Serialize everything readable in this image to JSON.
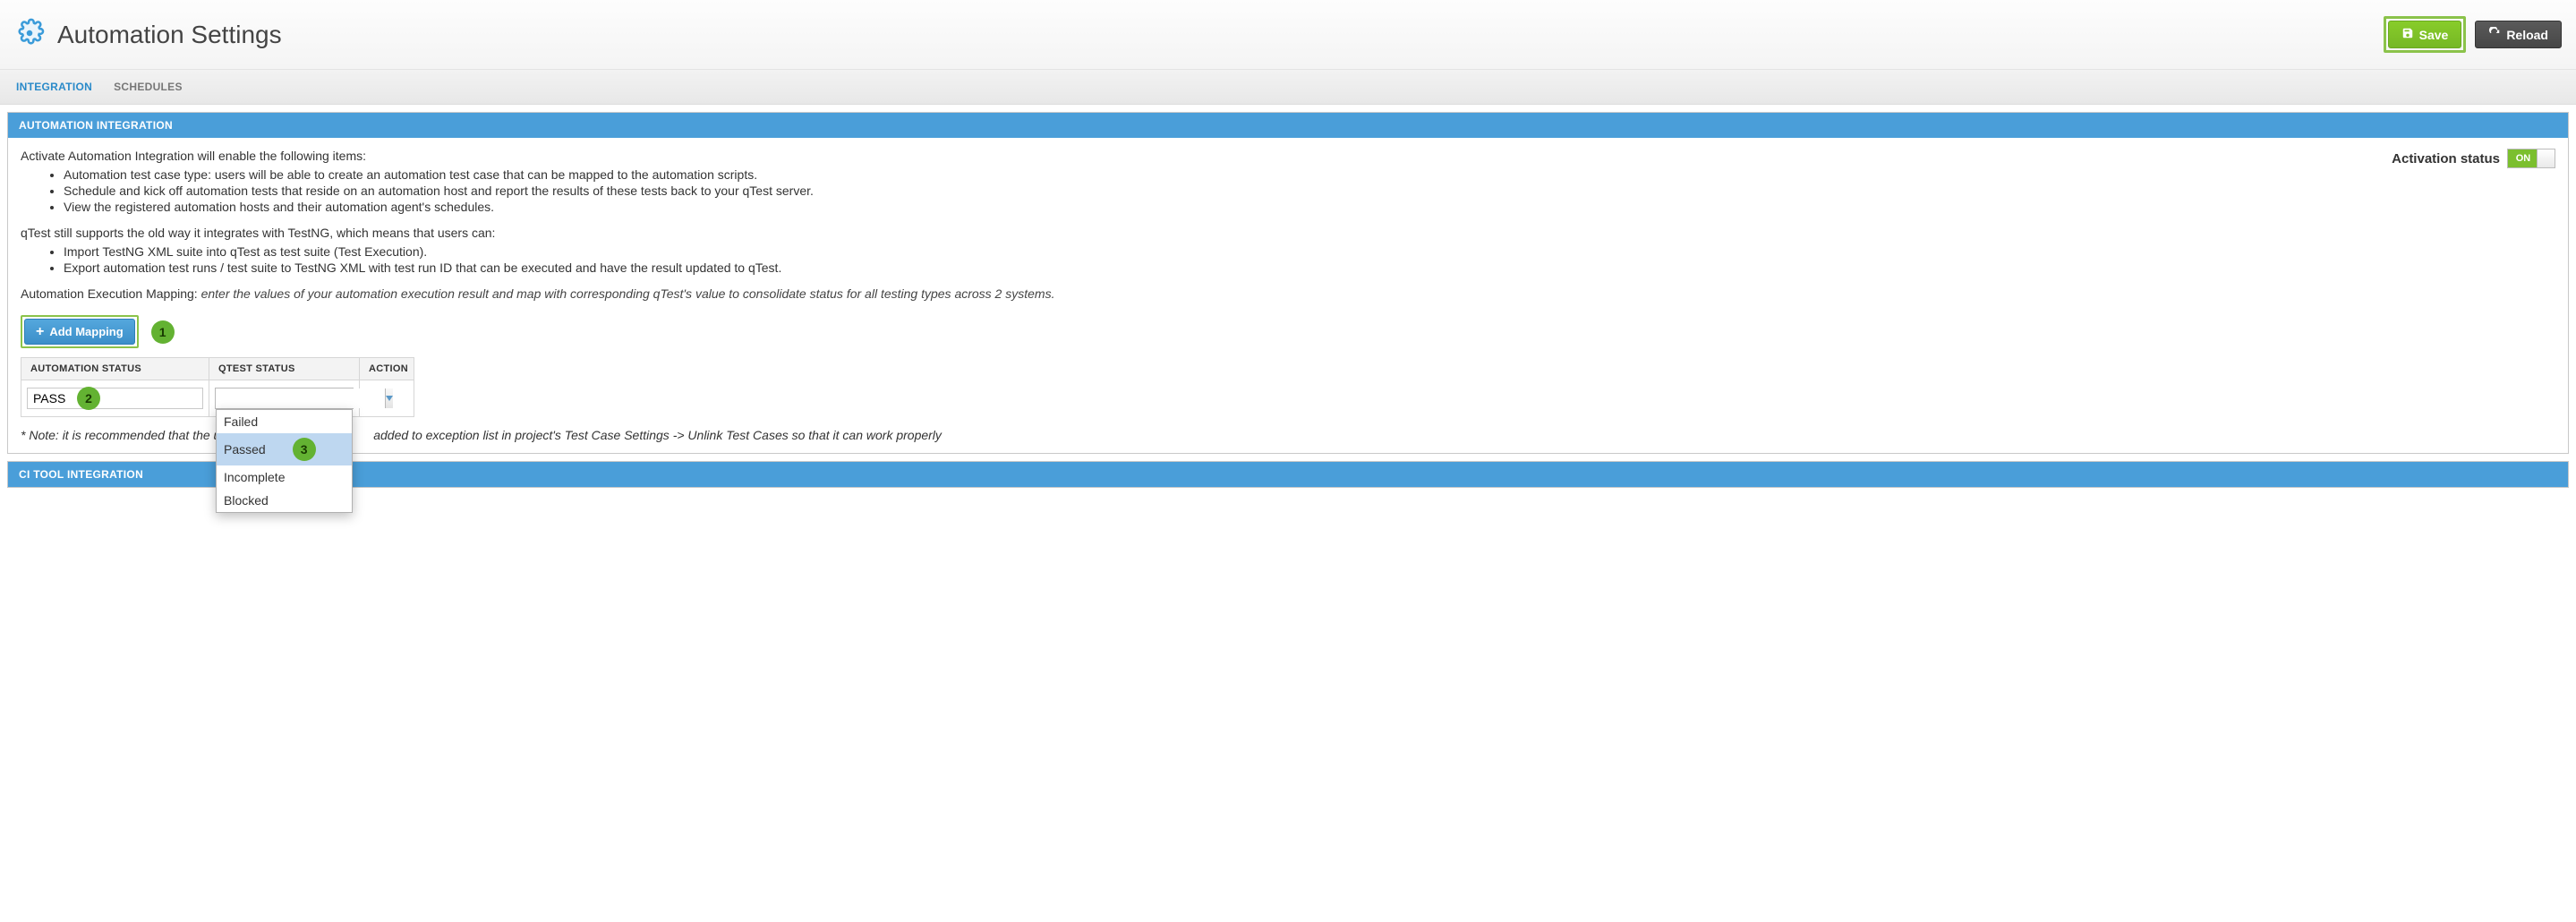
{
  "header": {
    "title": "Automation Settings",
    "save_label": "Save",
    "reload_label": "Reload"
  },
  "tabs": {
    "integration": "INTEGRATION",
    "schedules": "SCHEDULES"
  },
  "panel_auto": {
    "title": "AUTOMATION INTEGRATION",
    "intro": "Activate Automation Integration will enable the following items:",
    "bullets1": [
      "Automation test case type: users will be able to create an automation test case that can be mapped to the automation scripts.",
      "Schedule and kick off automation tests that reside on an automation host and report the results of these tests back to your qTest server.",
      "View the registered automation hosts and their automation agent's schedules."
    ],
    "intro2": "qTest still supports the old way it integrates with TestNG, which means that users can:",
    "bullets2": [
      "Import TestNG XML suite into qTest as test suite (Test Execution).",
      "Export automation test runs / test suite to TestNG XML with test run ID that can be executed and have the result updated to qTest."
    ],
    "mapping_label": "Automation Execution Mapping:",
    "mapping_hint": "enter the values of your automation execution result and map with corresponding qTest's value to consolidate status for all testing types across 2 systems.",
    "activation_label": "Activation status",
    "toggle_state": "ON",
    "add_mapping_label": "Add Mapping",
    "table": {
      "col_auto": "AUTOMATION STATUS",
      "col_qtest": "QTEST STATUS",
      "col_action": "ACTION",
      "row": {
        "auto_value": "PASS",
        "qtest_value": ""
      },
      "options": [
        "Failed",
        "Passed",
        "Incomplete",
        "Blocked"
      ],
      "selected_option_index": 1
    },
    "note_pre": "* Note: it is recommended that the us",
    "note_post": " added to exception list in project's Test Case Settings -> Unlink Test Cases so that it can work properly"
  },
  "panel_ci": {
    "title": "CI TOOL INTEGRATION"
  },
  "callouts": {
    "c1": "1",
    "c2": "2",
    "c3": "3"
  }
}
